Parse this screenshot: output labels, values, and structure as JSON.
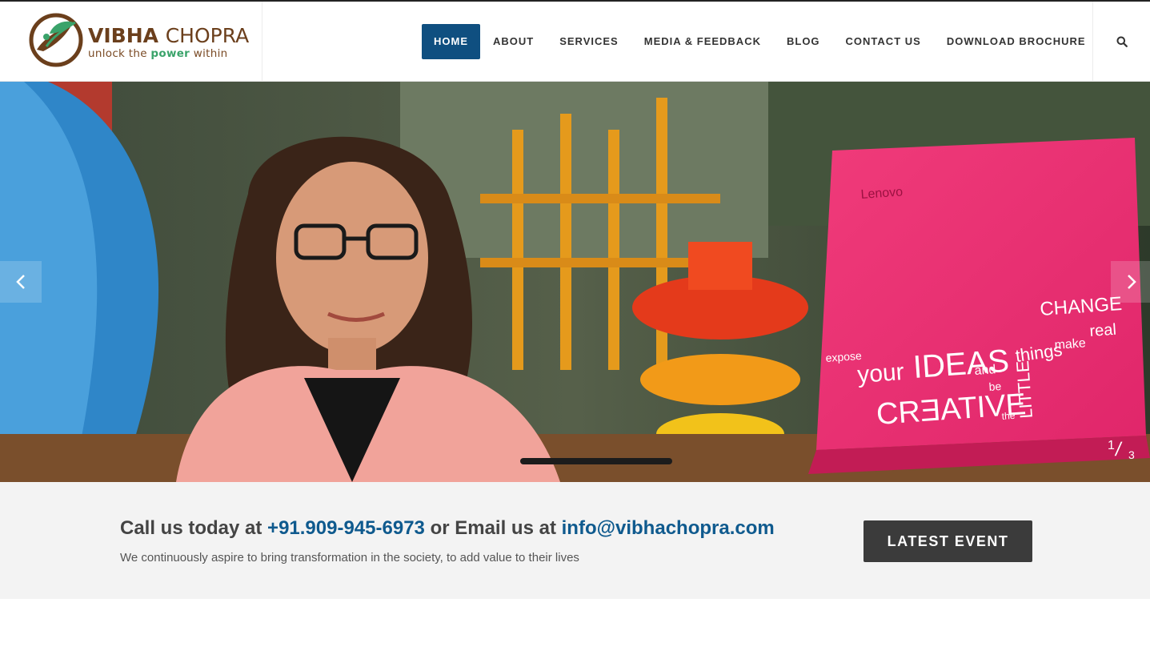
{
  "brand": {
    "name_first": "VIBHA",
    "name_second": "CHOPRA",
    "tagline_before": "unlock the",
    "tagline_highlight": "power",
    "tagline_after": "within",
    "colors": {
      "brown": "#6b3f1c",
      "green": "#3aa36a"
    }
  },
  "nav": {
    "items": [
      {
        "label": "HOME",
        "active": true
      },
      {
        "label": "ABOUT"
      },
      {
        "label": "SERVICES"
      },
      {
        "label": "MEDIA & FEEDBACK"
      },
      {
        "label": "BLOG"
      },
      {
        "label": "CONTACT US"
      },
      {
        "label": "DOWNLOAD BROCHURE"
      }
    ],
    "active_color": "#0f4f80",
    "search_icon": "search-icon"
  },
  "slider": {
    "current": "1",
    "separator": "/",
    "total": "3",
    "prev_icon": "chevron-left-icon",
    "next_icon": "chevron-right-icon",
    "laptop_brand": "Lenovo",
    "laptop_words": {
      "expose": "expose",
      "your": "your",
      "ideas": "IDEAS",
      "and": "and",
      "be": "be",
      "creative": "CRƎATIVE",
      "the": "the",
      "little": "LITTLE",
      "things": "things",
      "change": "CHANGE",
      "real": "real",
      "make": "make"
    }
  },
  "cta": {
    "prefix": "Call us today at",
    "phone": "+91.909-945-6973",
    "middle": "or Email us at",
    "email": "info@vibhachopra.com",
    "subtitle": "We continuously aspire to bring transformation in the society, to add value to their lives",
    "button_label": "LATEST EVENT"
  }
}
